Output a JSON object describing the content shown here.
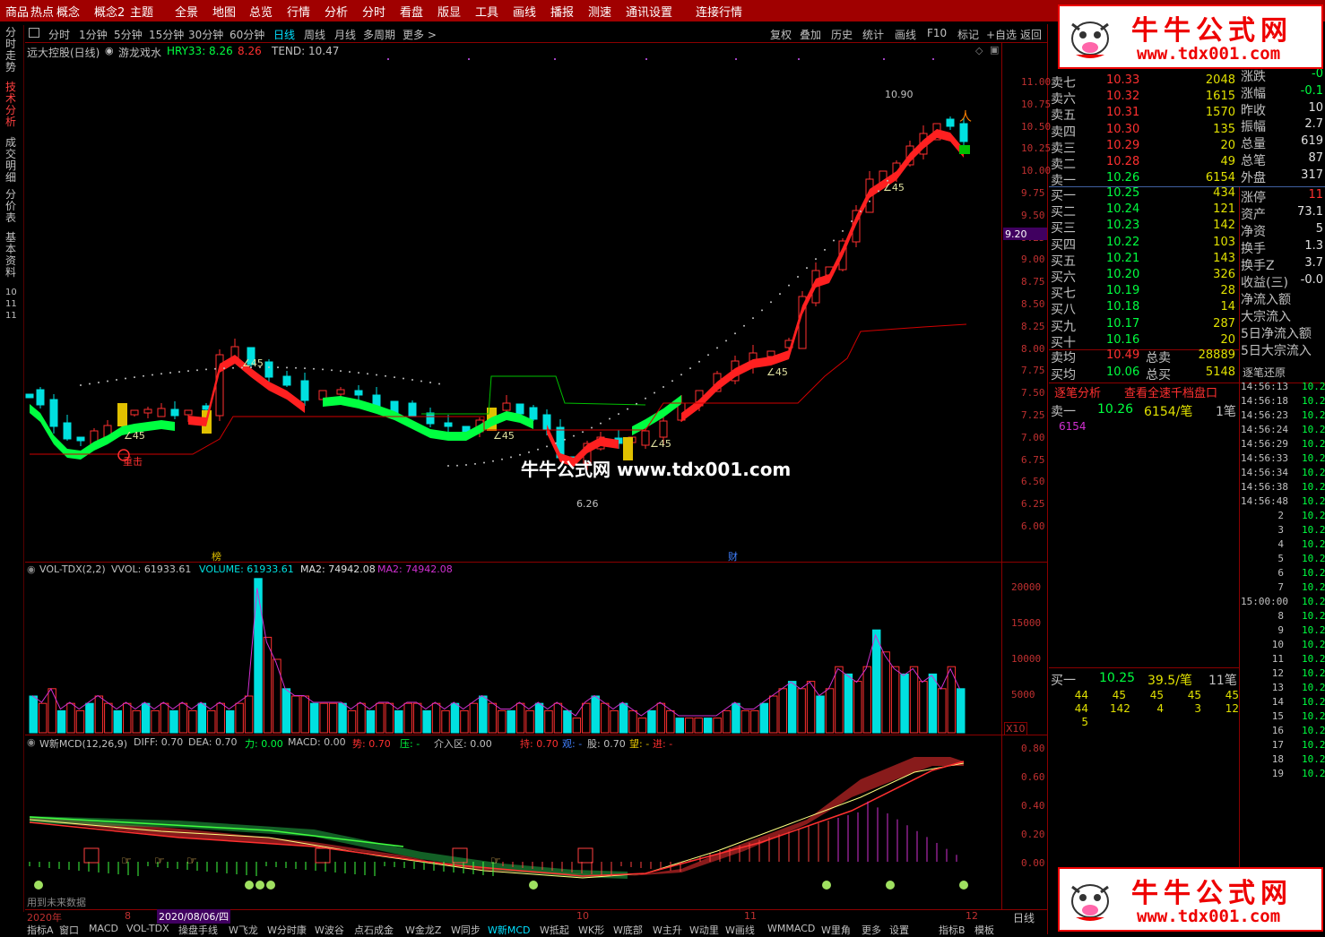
{
  "menu": [
    "商品",
    "热点",
    "概念",
    "概念2",
    "主题",
    "全景",
    "地图",
    "总览",
    "行情",
    "分析",
    "分时",
    "看盘",
    "版显",
    "工具",
    "画线",
    "播报",
    "测速",
    "通讯设置",
    "连接行情"
  ],
  "left_tabs": [
    "分时走势",
    "技术分析",
    "成交明细",
    "分价表",
    "基本资料"
  ],
  "left_tabs_active": 1,
  "left_nums": [
    "10",
    "11",
    "11"
  ],
  "periods": [
    "分时",
    "1分钟",
    "5分钟",
    "15分钟",
    "30分钟",
    "60分钟",
    "日线",
    "周线",
    "月线",
    "多周期",
    "更多 >"
  ],
  "period_selected": 6,
  "right_buttons": [
    "复权",
    "叠加",
    "历史",
    "统计",
    "画线",
    "F10",
    "标记",
    "+自选",
    "返回"
  ],
  "main_info": {
    "name": "远大控股(日线)",
    "indicator": "游龙戏水",
    "hry_label": "HRY33: 8.26",
    "hry_val2": "8.26",
    "tend": "TEND: 10.47"
  },
  "price_axis": [
    "11.00",
    "10.75",
    "10.50",
    "10.25",
    "10.00",
    "9.75",
    "9.50",
    "9.25",
    "9.00",
    "8.75",
    "8.50",
    "8.25",
    "8.00",
    "7.75",
    "7.50",
    "7.25",
    "7.00",
    "6.75",
    "6.50",
    "6.25",
    "6.00"
  ],
  "price_marker": "9.20",
  "annotations": {
    "high": "10.90",
    "low": "6.26",
    "angle": "∠45",
    "tag1": "榜",
    "tag2": "财",
    "strike": "重击"
  },
  "watermark": "牛牛公式网 www.tdx001.com",
  "vol_info": {
    "name": "VOL-TDX(2,2)",
    "vvol": "VVOL: 61933.61",
    "volume": "VOLUME: 61933.61",
    "ma2": "MA2: 74942.08",
    "ma2b": "MA2: 74942.08"
  },
  "vol_axis": [
    "20000",
    "15000",
    "10000",
    "5000"
  ],
  "vol_unit": "X10",
  "macd_info": {
    "name": "W新MCD(12,26,9)",
    "diff": "DIFF: 0.70",
    "dea": "DEA: 0.70",
    "li": "力: 0.00",
    "macd": "MACD: 0.00",
    "shi": "势: 0.70",
    "ya": "压: -",
    "jieru": "介入区: 0.00",
    "chi": "持: 0.70",
    "guan": "观: -",
    "gu": "股: 0.70",
    "wang": "望: -",
    "jin": "进: -"
  },
  "macd_axis": [
    "0.80",
    "0.60",
    "0.40",
    "0.20",
    "0.00"
  ],
  "future_note": "用到未来数据",
  "date_bar": {
    "year": "2020年",
    "m8": "8",
    "date": "2020/08/06/四",
    "m10": "10",
    "m11": "11",
    "m12": "12",
    "period": "日线"
  },
  "bottom_tabs": [
    "指标A",
    "窗口",
    "MACD",
    "VOL-TDX",
    "操盘手线",
    "W飞龙",
    "W分时康",
    "W波谷",
    "点石成金",
    "W金龙Z",
    "W同步",
    "W新MCD",
    "W抵起",
    "WK形",
    "W底部",
    "W主升",
    "W动里",
    "W画线",
    "WMMACD",
    "W里角",
    "更多",
    "设置",
    "指标B",
    "模板"
  ],
  "asks": [
    {
      "label": "卖七",
      "price": "10.33",
      "vol": "2048"
    },
    {
      "label": "卖六",
      "price": "10.32",
      "vol": "1615"
    },
    {
      "label": "卖五",
      "price": "10.31",
      "vol": "1570"
    },
    {
      "label": "卖四",
      "price": "10.30",
      "vol": "135"
    },
    {
      "label": "卖三",
      "price": "10.29",
      "vol": "20"
    },
    {
      "label": "卖二",
      "price": "10.28",
      "vol": "49"
    },
    {
      "label": "卖一",
      "price": "10.26",
      "vol": "6154"
    }
  ],
  "bids": [
    {
      "label": "买一",
      "price": "10.25",
      "vol": "434"
    },
    {
      "label": "买二",
      "price": "10.24",
      "vol": "121"
    },
    {
      "label": "买三",
      "price": "10.23",
      "vol": "142"
    },
    {
      "label": "买四",
      "price": "10.22",
      "vol": "103"
    },
    {
      "label": "买五",
      "price": "10.21",
      "vol": "143"
    },
    {
      "label": "买六",
      "price": "10.20",
      "vol": "326"
    },
    {
      "label": "买七",
      "price": "10.19",
      "vol": "28"
    },
    {
      "label": "买八",
      "price": "10.18",
      "vol": "14"
    },
    {
      "label": "买九",
      "price": "10.17",
      "vol": "287"
    },
    {
      "label": "买十",
      "price": "10.16",
      "vol": "20"
    }
  ],
  "summary": [
    {
      "l": "卖均",
      "v": "10.49",
      "l2": "总卖",
      "v2": "28889"
    },
    {
      "l": "买均",
      "v": "10.06",
      "l2": "总买",
      "v2": "5148"
    }
  ],
  "stats1": [
    {
      "l": "涨跌",
      "v": "-0"
    },
    {
      "l": "涨幅",
      "v": "-0.1"
    },
    {
      "l": "昨收",
      "v": "10"
    },
    {
      "l": "振幅",
      "v": "2.7"
    },
    {
      "l": "总量",
      "v": "619"
    },
    {
      "l": "总笔",
      "v": "87"
    },
    {
      "l": "外盘",
      "v": "317"
    }
  ],
  "stats2": [
    {
      "l": "涨停",
      "v": "11"
    },
    {
      "l": "资产",
      "v": "73.1"
    },
    {
      "l": "净资",
      "v": "5"
    },
    {
      "l": "换手",
      "v": "1.3"
    },
    {
      "l": "换手Z",
      "v": "3.7"
    },
    {
      "l": "收益(三)",
      "v": "-0.0"
    },
    {
      "l": "净流入额",
      "v": ""
    },
    {
      "l": "大宗流入",
      "v": ""
    },
    {
      "l": "5日净流入额",
      "v": ""
    },
    {
      "l": "5日大宗流入",
      "v": ""
    }
  ],
  "trade_tabs": {
    "a": "逐笔分析",
    "b": "查看全速千档盘口",
    "c": "逐笔还原"
  },
  "sell1": {
    "l": "卖一",
    "p": "10.26",
    "v": "6154/笔",
    "n": "1笔",
    "sub": "6154"
  },
  "buy1": {
    "l": "买一",
    "p": "10.25",
    "v": "39.5/笔",
    "n": "11笔"
  },
  "buy_grid": [
    [
      "44",
      "45",
      "45",
      "45",
      "45"
    ],
    [
      "44",
      "142",
      "4",
      "3",
      "12"
    ],
    [
      "5",
      "",
      "",
      "",
      ""
    ]
  ],
  "ticks": [
    "14:56:13",
    "14:56:18",
    "14:56:23",
    "14:56:24",
    "14:56:29",
    "14:56:33",
    "14:56:34",
    "14:56:38",
    "14:56:48",
    "2",
    "3",
    "4",
    "5",
    "6",
    "7",
    "15:00:00",
    "8",
    "9",
    "10",
    "11",
    "12",
    "13",
    "14",
    "15",
    "16",
    "17",
    "18",
    "19"
  ],
  "tick_price": "10.2",
  "ad": {
    "title": "牛牛公式网",
    "url": "www.tdx001.com"
  },
  "colors": {
    "menu": "#a00000",
    "up": "#ff3030",
    "down": "#00e0e0",
    "gold": "#e0c000",
    "green": "#00ff40",
    "red": "#e00000",
    "magenta": "#d030d0"
  }
}
